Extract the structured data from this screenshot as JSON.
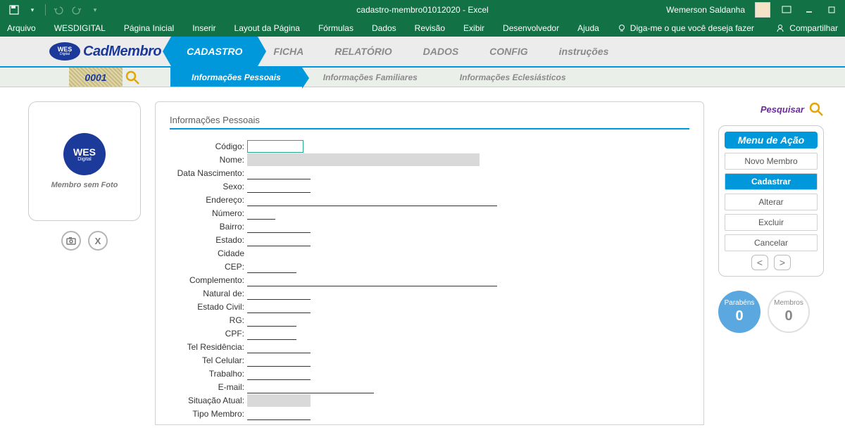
{
  "window": {
    "title": "cadastro-membro01012020 - Excel",
    "user": "Wemerson Saldanha"
  },
  "ribbon": [
    "Arquivo",
    "WESDIGITAL",
    "Página Inicial",
    "Inserir",
    "Layout da Página",
    "Fórmulas",
    "Dados",
    "Revisão",
    "Exibir",
    "Desenvolvedor",
    "Ajuda"
  ],
  "tellme": "Diga-me o que você deseja fazer",
  "share": "Compartilhar",
  "app": {
    "name": "CadMembro",
    "logo_top": "WES",
    "logo_sub": "Digital"
  },
  "main_tabs": [
    "CADASTRO",
    "FICHA",
    "RELATÓRIO",
    "DADOS",
    "CONFIG",
    "instruções"
  ],
  "main_active": 0,
  "id_value": "0001",
  "sub_tabs": [
    "Informações Pessoais",
    "Informações Familiares",
    "Informações Eclesiásticos"
  ],
  "sub_active": 0,
  "photo": {
    "logo_top": "WES",
    "logo_sub": "Digital",
    "empty_text": "Membro sem Foto"
  },
  "form": {
    "title": "Informações Pessoais",
    "labels": {
      "codigo": "Código:",
      "nome": "Nome:",
      "nasc": "Data Nascimento:",
      "sexo": "Sexo:",
      "endereco": "Endereço:",
      "numero": "Número:",
      "bairro": "Bairro:",
      "estado": "Estado:",
      "cidade": "Cidade",
      "cep": "CEP:",
      "compl": "Complemento:",
      "natural": "Natural de:",
      "civil": "Estado Civil:",
      "rg": "RG:",
      "cpf": "CPF:",
      "telres": "Tel Residência:",
      "telcel": "Tel Celular:",
      "trab": "Trabalho:",
      "email": "E-mail:",
      "sit": "Situação Atual:",
      "tipo": "Tipo Membro:"
    }
  },
  "search_link": "Pesquisar",
  "actions": {
    "header": "Menu de Ação",
    "items": [
      "Novo Membro",
      "Cadastrar",
      "Alterar",
      "Excluir",
      "Cancelar"
    ],
    "primary_index": 1
  },
  "stats": {
    "left_label": "Parabéns",
    "left_value": "0",
    "right_label": "Membros",
    "right_value": "0"
  }
}
